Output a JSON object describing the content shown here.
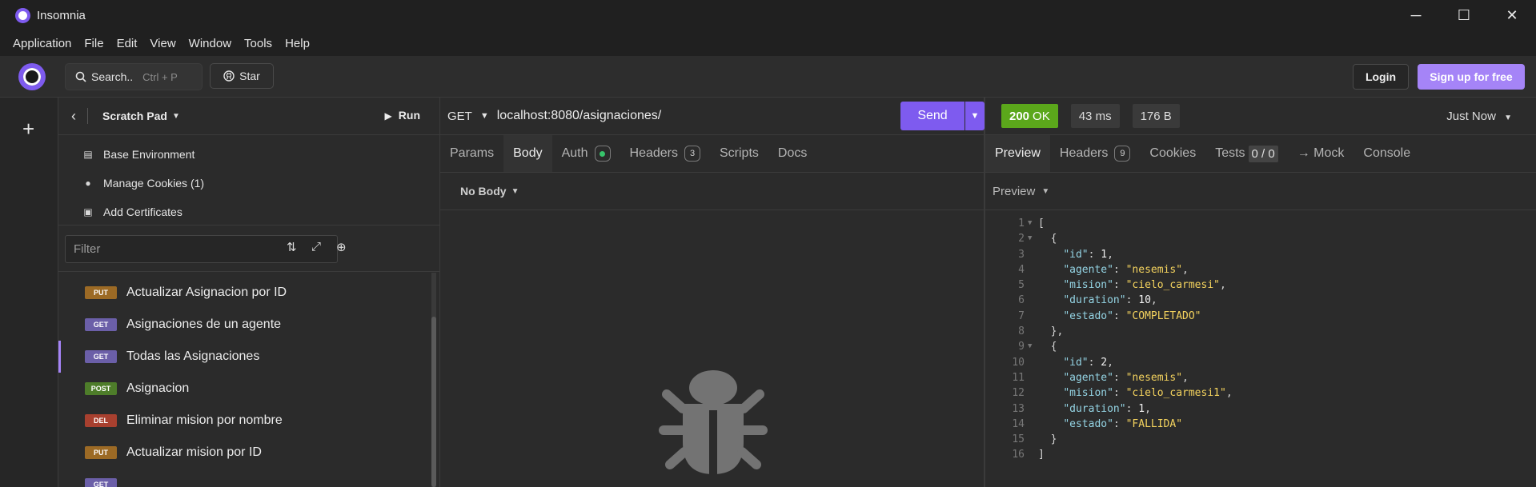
{
  "window": {
    "title": "Insomnia",
    "controls": [
      "minimize",
      "maximize",
      "close"
    ]
  },
  "menu": [
    "Application",
    "File",
    "Edit",
    "View",
    "Window",
    "Tools",
    "Help"
  ],
  "header": {
    "search_label": "Search..",
    "search_shortcut": "Ctrl + P",
    "star_label": "Star",
    "login_label": "Login",
    "signup_label": "Sign up for free"
  },
  "sidebar": {
    "title": "Scratch Pad",
    "run_label": "Run",
    "links": [
      "Base Environment",
      "Manage Cookies (1)",
      "Add Certificates"
    ],
    "filter_placeholder": "Filter",
    "requests": [
      {
        "method": "PUT",
        "name": "Actualizar Asignacion por ID",
        "color": "#9c6a25",
        "active": false
      },
      {
        "method": "GET",
        "name": "Asignaciones de un agente",
        "color": "#6b5fa8",
        "active": false
      },
      {
        "method": "GET",
        "name": "Todas las Asignaciones",
        "color": "#6b5fa8",
        "active": true
      },
      {
        "method": "POST",
        "name": "Asignacion",
        "color": "#4e7d2a",
        "active": false
      },
      {
        "method": "DEL",
        "name": "Eliminar mision por nombre",
        "color": "#a8402f",
        "active": false
      },
      {
        "method": "PUT",
        "name": "Actualizar mision por ID",
        "color": "#9c6a25",
        "active": false
      },
      {
        "method": "GET",
        "name": "",
        "color": "#6b5fa8",
        "active": false
      }
    ]
  },
  "request": {
    "method": "GET",
    "url": "localhost:8080/asignaciones/",
    "send_label": "Send",
    "tabs": [
      "Params",
      "Body",
      "Auth",
      "Headers",
      "Scripts",
      "Docs"
    ],
    "active_tab": "Body",
    "headers_count": "3",
    "body_mode": "No Body"
  },
  "response": {
    "status_code": "200",
    "status_text": "OK",
    "time": "43 ms",
    "size": "176 B",
    "timestamp": "Just Now",
    "tabs": [
      "Preview",
      "Headers",
      "Cookies",
      "Tests",
      "→ Mock",
      "Console"
    ],
    "active_tab": "Preview",
    "headers_count": "9",
    "tests_count": "0 / 0",
    "preview_mode": "Preview",
    "body": [
      {
        "id": 1,
        "agente": "nesemis",
        "mision": "cielo_carmesi",
        "duration": 10,
        "estado": "COMPLETADO"
      },
      {
        "id": 2,
        "agente": "nesemis",
        "mision": "cielo_carmesi1",
        "duration": 1,
        "estado": "FALLIDA"
      }
    ]
  },
  "colors": {
    "accent": "#7e5bef",
    "signup": "#a584f7",
    "status_ok": "#5ba71b"
  }
}
